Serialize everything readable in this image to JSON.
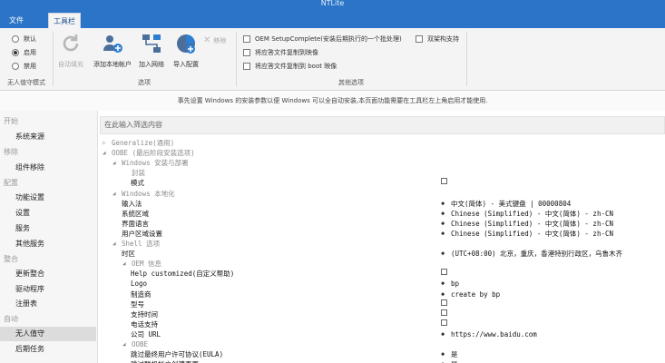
{
  "app": {
    "title": "NTLite"
  },
  "tabs": [
    {
      "label": "文件"
    },
    {
      "label": "工具栏"
    }
  ],
  "ribbon": {
    "mode_group": {
      "label": "无人值守模式",
      "options": [
        {
          "label": "默认",
          "selected": false
        },
        {
          "label": "启用",
          "selected": true
        },
        {
          "label": "禁用",
          "selected": false
        }
      ]
    },
    "options_group": {
      "label": "选项",
      "buttons": [
        {
          "label": "自动填充",
          "icon": "refresh-icon",
          "enabled": false
        },
        {
          "label": "添加本地帐户",
          "icon": "users-add-icon",
          "enabled": true
        },
        {
          "label": "加入网络",
          "icon": "network-icon",
          "enabled": true
        },
        {
          "label": "导入配置",
          "icon": "import-config-icon",
          "enabled": true
        }
      ],
      "remove": {
        "label": "移除",
        "icon": "close-icon",
        "enabled": false
      }
    },
    "other_group": {
      "label": "其他选项",
      "checkboxes": [
        {
          "label": "OEM SetupComplete(安装后期执行的一个批处理)"
        },
        {
          "label": "将应答文件复制到映像"
        },
        {
          "label": "将应答文件复制到 boot 映像"
        },
        {
          "label": "双架构支持"
        }
      ]
    }
  },
  "info_text": "事先设置 Windows 的安装参数以便 Windows 可以全自动安装,本页面功能需要在工具栏左上角启用才能使用.",
  "search": {
    "placeholder": "在此输入筛选内容"
  },
  "sidebar": [
    {
      "label": "开始",
      "type": "category"
    },
    {
      "label": "系统来源",
      "type": "item"
    },
    {
      "label": "移除",
      "type": "category"
    },
    {
      "label": "组件移除",
      "type": "item"
    },
    {
      "label": "配置",
      "type": "category"
    },
    {
      "label": "功能设置",
      "type": "item"
    },
    {
      "label": "设置",
      "type": "item"
    },
    {
      "label": "服务",
      "type": "item"
    },
    {
      "label": "其他服务",
      "type": "item"
    },
    {
      "label": "整合",
      "type": "category"
    },
    {
      "label": "更新整合",
      "type": "item"
    },
    {
      "label": "驱动程序",
      "type": "item"
    },
    {
      "label": "注册表",
      "type": "item"
    },
    {
      "label": "自动",
      "type": "category"
    },
    {
      "label": "无人值守",
      "type": "item",
      "selected": true
    },
    {
      "label": "后期任务",
      "type": "item"
    }
  ],
  "tree": [
    {
      "label": "Generalize(通用)",
      "level": 0,
      "kind": "group",
      "arrow": "collapsed"
    },
    {
      "label": "OOBE (最后阶段安装选项)",
      "level": 0,
      "kind": "group",
      "arrow": "expanded"
    },
    {
      "label": "Windows 安装与部署",
      "level": 1,
      "kind": "group",
      "arrow": "expanded"
    },
    {
      "label": "封装",
      "level": 2,
      "kind": "group"
    },
    {
      "label": "模式",
      "level": 2,
      "kind": "setting",
      "value_type": "checkbox"
    },
    {
      "label": "Windows 本地化",
      "level": 1,
      "kind": "group",
      "arrow": "expanded"
    },
    {
      "label": "输入法",
      "level": 1,
      "kind": "setting",
      "value_type": "dot",
      "value": "中文(简体) - 美式键盘 | 00000804"
    },
    {
      "label": "系统区域",
      "level": 1,
      "kind": "setting",
      "value_type": "dot",
      "value": "Chinese (Simplified) - 中文(简体) - zh-CN"
    },
    {
      "label": "界面语言",
      "level": 1,
      "kind": "setting",
      "value_type": "dot",
      "value": "Chinese (Simplified) - 中文(简体) - zh-CN"
    },
    {
      "label": "用户区域设置",
      "level": 1,
      "kind": "setting",
      "value_type": "dot",
      "value": "Chinese (Simplified) - 中文(简体) - zh-CN"
    },
    {
      "label": "Shell 选项",
      "level": 1,
      "kind": "group",
      "arrow": "expanded"
    },
    {
      "label": "时区",
      "level": 1,
      "kind": "setting",
      "value_type": "dot",
      "value": "(UTC+08:00) 北京，重庆，香港特别行政区，乌鲁木齐"
    },
    {
      "label": "OEM 信息",
      "level": 2,
      "kind": "group",
      "arrow": "expanded"
    },
    {
      "label": "Help customized(自定义帮助)",
      "level": 2,
      "kind": "setting",
      "value_type": "checkbox"
    },
    {
      "label": "Logo",
      "level": 2,
      "kind": "setting",
      "value_type": "dot",
      "value": "bp"
    },
    {
      "label": "制造商",
      "level": 2,
      "kind": "setting",
      "value_type": "dot",
      "value": "create by bp"
    },
    {
      "label": "型号",
      "level": 2,
      "kind": "setting",
      "value_type": "checkbox"
    },
    {
      "label": "支持时间",
      "level": 2,
      "kind": "setting",
      "value_type": "checkbox"
    },
    {
      "label": "电话支持",
      "level": 2,
      "kind": "setting",
      "value_type": "checkbox"
    },
    {
      "label": "公司 URL",
      "level": 2,
      "kind": "setting",
      "value_type": "dot",
      "value": "https://www.baidu.com"
    },
    {
      "label": "OOBE",
      "level": 2,
      "kind": "group",
      "arrow": "expanded"
    },
    {
      "label": "跳过最终用户许可协议(EULA)",
      "level": 2,
      "kind": "setting",
      "value_type": "dot",
      "value": "是"
    },
    {
      "label": "跳过联机帐户创建页面",
      "level": 2,
      "kind": "setting",
      "value_type": "dot",
      "value": "是"
    }
  ]
}
